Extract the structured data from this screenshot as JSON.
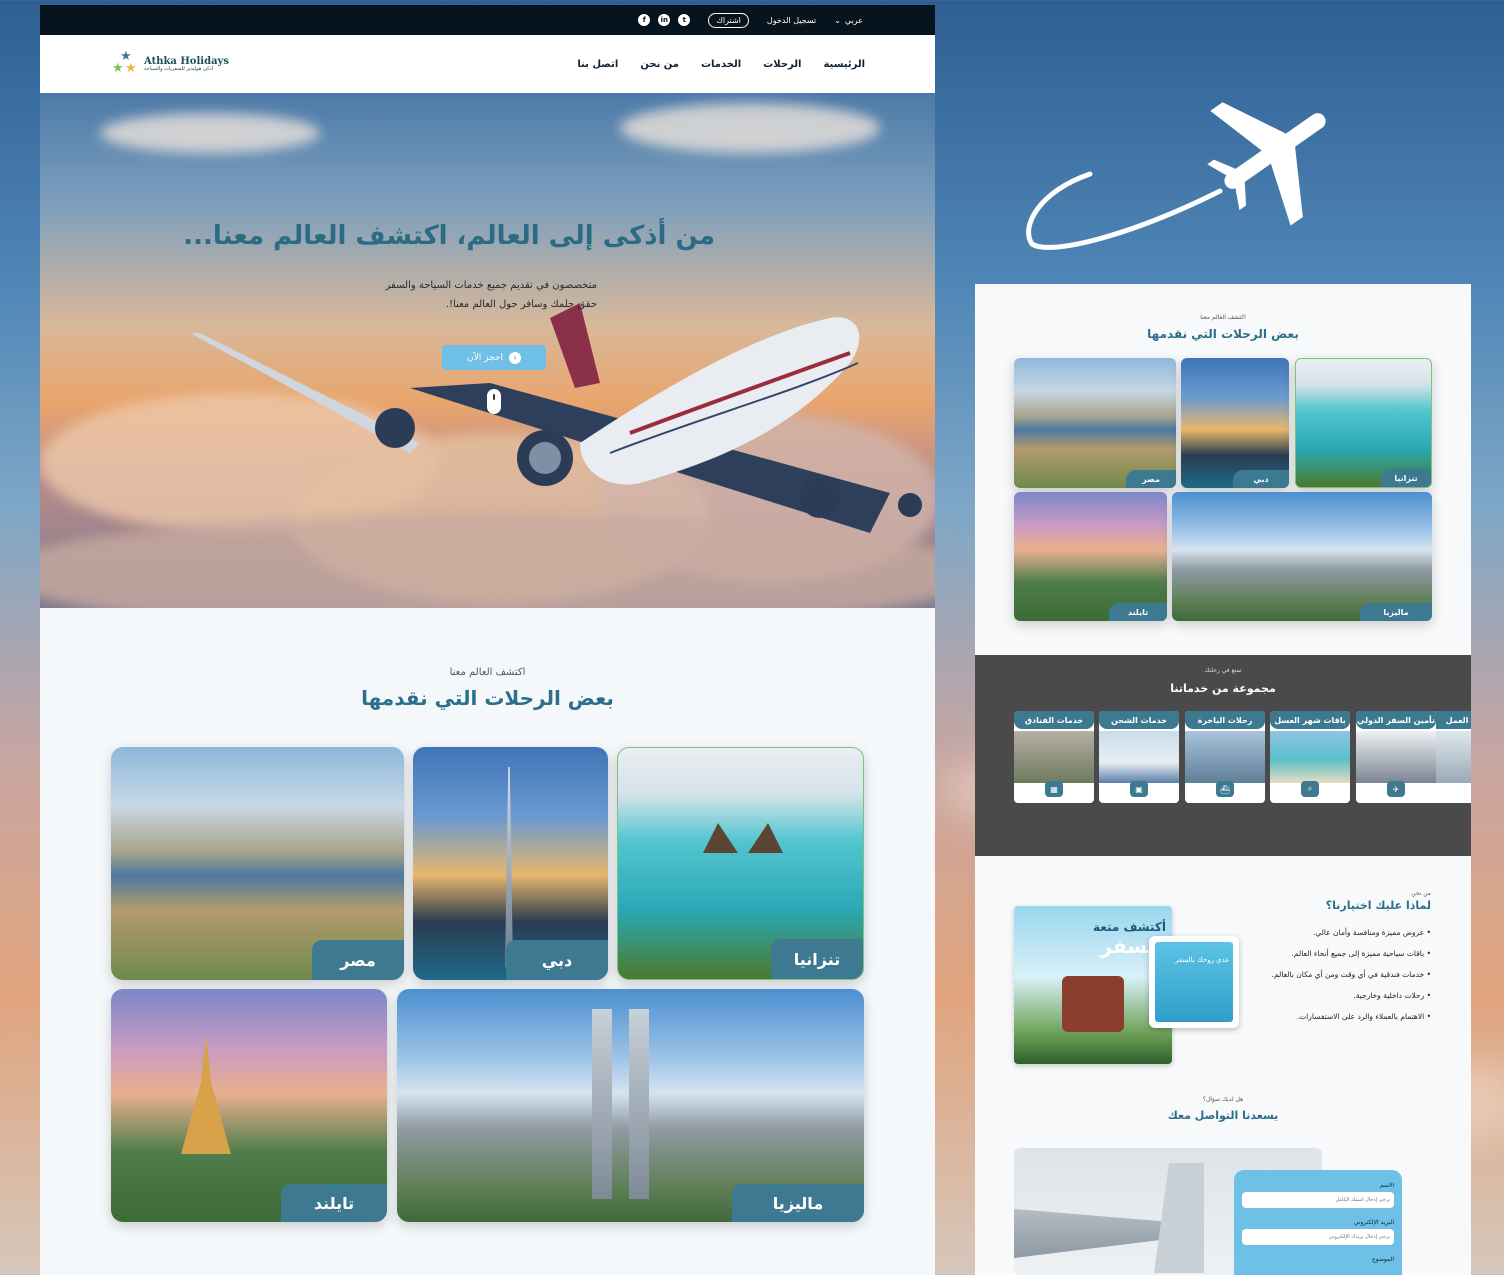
{
  "topbar": {
    "lang": "عربي",
    "login": "تسجيل الدخول",
    "signup": "اشتراك",
    "social": [
      "facebook-icon",
      "linkedin-icon",
      "twitter-icon"
    ]
  },
  "nav": {
    "items": [
      "الرئيسية",
      "الرحلات",
      "الخدمات",
      "من نحن",
      "اتصل بنا"
    ]
  },
  "logo": {
    "name": "Athka Holidays",
    "tagline": "أذكى هوليديز للسفريات والسياحة"
  },
  "hero": {
    "title": "من أذكى إلى العالم، اكتشف العالم معنا...",
    "sub1": "متخصصون في تقديم جميع خدمات السياحة والسفر",
    "sub2": "حقق حلمك وسافر حول العالم معنا!.",
    "button": "احجز الآن"
  },
  "trips": {
    "kicker": "اكتشف العالم معنا",
    "title": "بعض الرحلات التي نقدمها",
    "destinations": [
      "مصر",
      "دبي",
      "تنزانيا",
      "تايلند",
      "ماليزيا"
    ]
  },
  "services": {
    "kicker": "تمتع في رحلتك",
    "title": "مجموعة من خدماتنا",
    "items": [
      "العمل",
      "تأمين السفر الدولي",
      "باقات شهر العسل",
      "رحلات الباخرة",
      "خدمات الشحن",
      "خدمات الفنادق"
    ]
  },
  "why": {
    "kicker": "من نحن",
    "title": "لماذا عليك اختيارنا؟",
    "points": [
      "عروض مميزة ومنافسة وأمان عالي.",
      "باقات سياحية مميزة إلى جميع أنحاء العالم.",
      "خدمات فندقية في أي وقت ومن أي مكان بالعالم.",
      "رحلات داخلية وخارجية.",
      "الاهتمام بالعملاء والرد على الاستفسارات."
    ]
  },
  "poster": {
    "title": "أكتشف متعة",
    "big": "السفر",
    "small": "غدي روحك بالسفر"
  },
  "contact": {
    "kicker": "هل لديك سؤال؟",
    "title": "يسعدنا التواصل معك",
    "name_label": "الاسم",
    "name_placeholder": "يرجى إدخال اسمك الكامل",
    "email_label": "البريد الإلكتروني",
    "email_placeholder": "يرجى إدخال بريدك الإلكتروني",
    "subject_label": "الموضوع"
  },
  "colors": {
    "accent": "#3d7a92",
    "sky": "#6fc0e6",
    "title": "#2c6f8a"
  }
}
